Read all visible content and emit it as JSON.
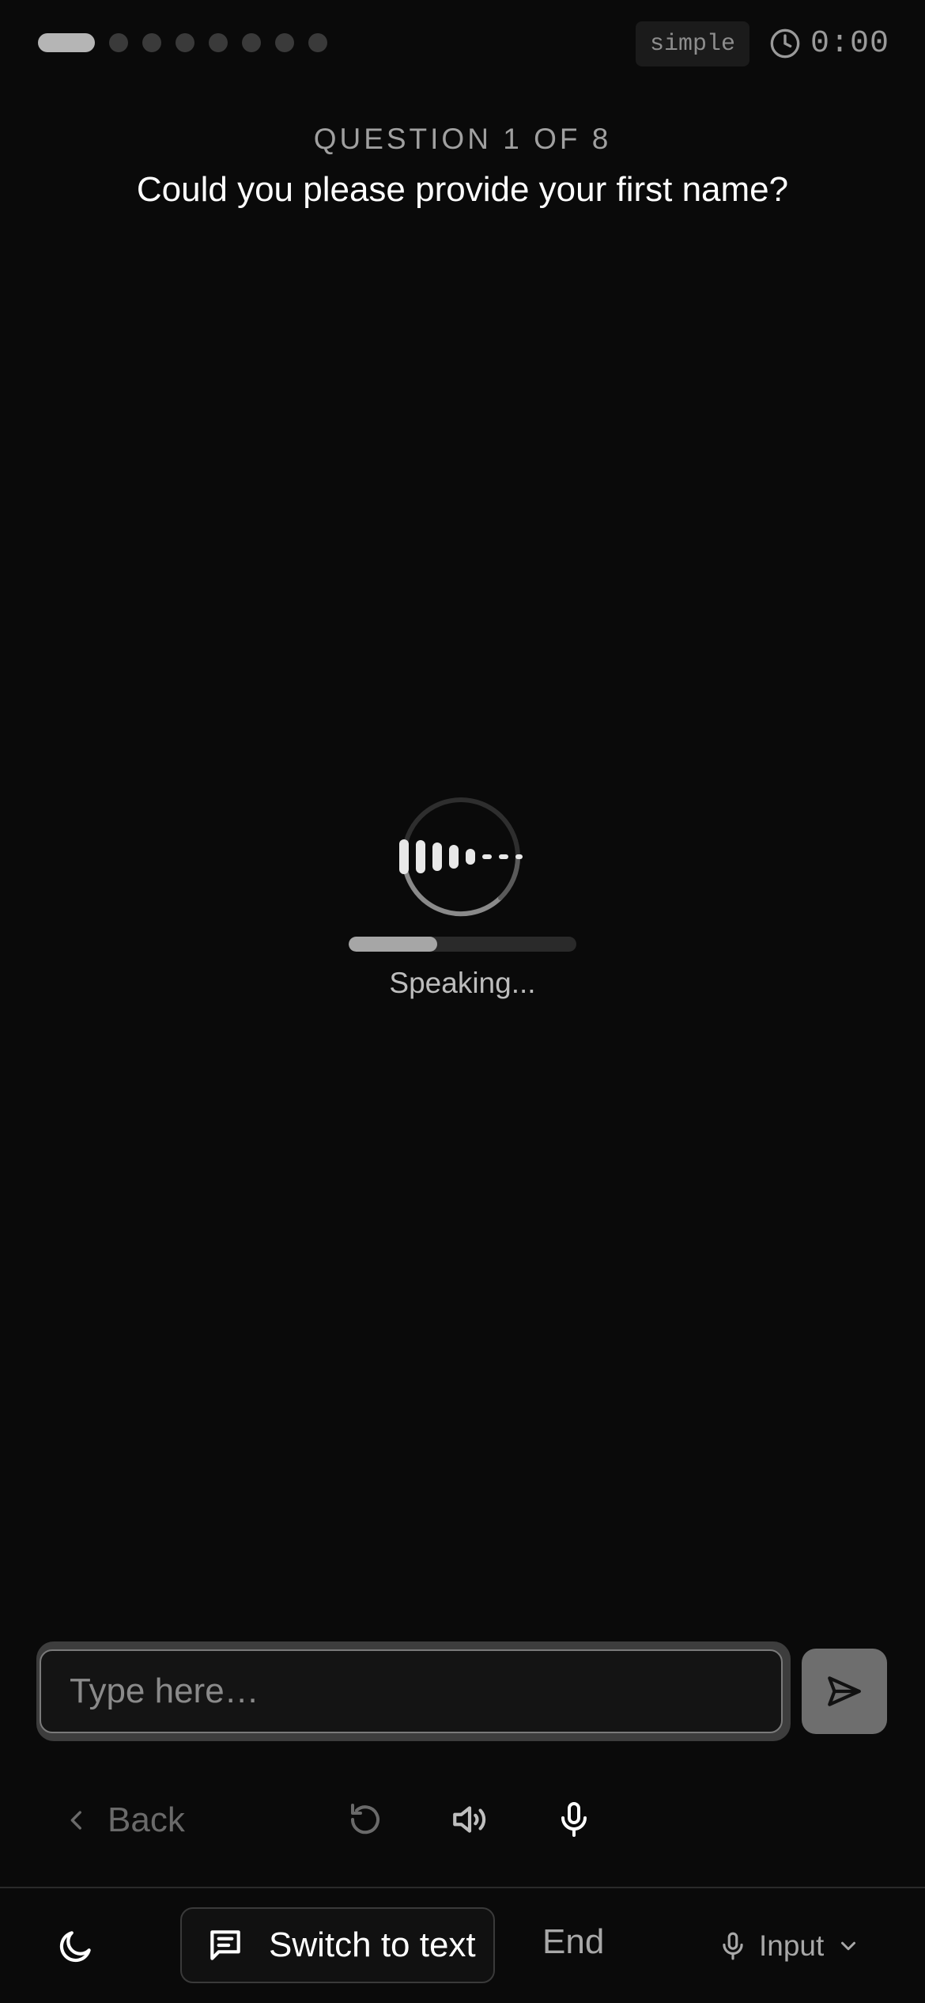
{
  "progress": {
    "total": 8,
    "current": 1
  },
  "mode_badge": "simple",
  "timer": {
    "value": "0:00",
    "icon": "clock-icon"
  },
  "question": {
    "header": "QUESTION 1 OF 8",
    "text": "Could you please provide your first name?"
  },
  "speaking": {
    "status": "Speaking...",
    "progress": 0.39,
    "icon": "waveform-icon"
  },
  "input": {
    "placeholder": "Type here…",
    "value": "",
    "send_icon": "send-icon"
  },
  "controls": {
    "back_label": "Back",
    "back_icon": "chevron-left-icon",
    "replay_icon": "replay-icon",
    "volume_icon": "volume-icon",
    "mic_icon": "microphone-icon"
  },
  "bottom_bar": {
    "theme_icon": "moon-icon",
    "switch_label": "Switch to text",
    "switch_icon": "message-icon",
    "end_label": "End",
    "input_label": "Input",
    "input_icon": "microphone-icon",
    "input_chevron": "chevron-down-icon"
  },
  "colors": {
    "background": "#0a0a0a",
    "accent": "#b5b5b5",
    "text_primary": "#ffffff",
    "text_muted": "#a0a0a0"
  }
}
